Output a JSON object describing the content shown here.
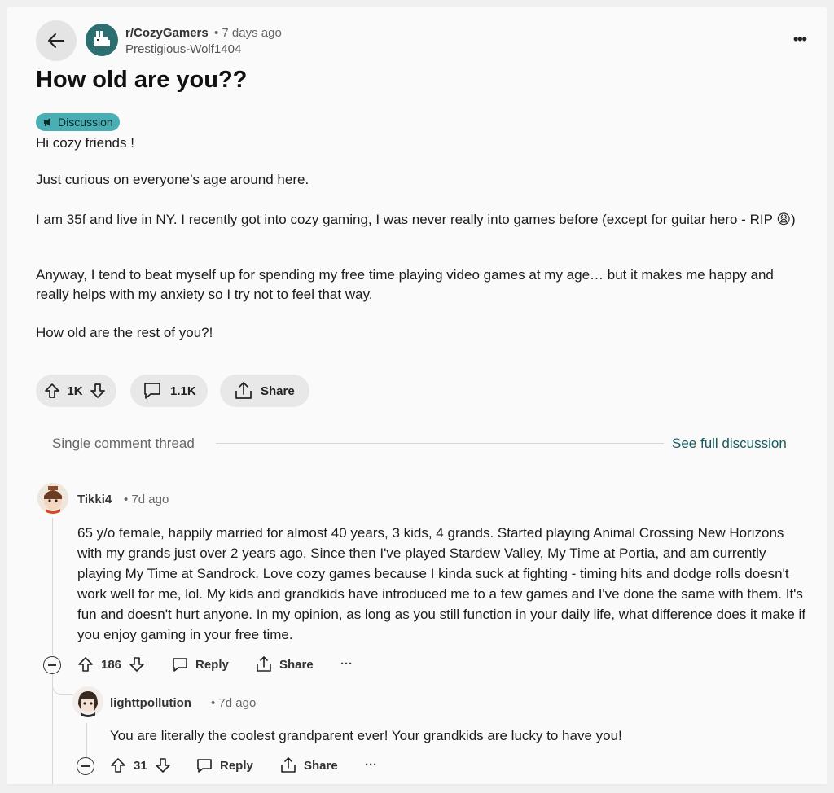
{
  "post": {
    "subreddit": "r/CozyGamers",
    "time": "• 7 days ago",
    "author": "Prestigious-Wolf1404",
    "title": "How old are you??",
    "flair": "Discussion",
    "body": [
      "Hi cozy friends !",
      "Just curious on everyone’s age around here.",
      "I am 35f and live in NY. I recently got into cozy gaming, I was never really into games before (except for guitar hero - RIP 😩)",
      "Anyway, I tend to beat myself up for spending my free time playing video games at my age… but it makes me happy and really helps with my anxiety so I try not to feel that way.",
      "How old are the rest of you?!"
    ],
    "votes": "1K",
    "comments": "1.1K",
    "share": "Share"
  },
  "thread": {
    "label": "Single comment thread",
    "see_full": "See full discussion"
  },
  "comments": [
    {
      "user": "Tikki4",
      "time": "• 7d ago",
      "text": "65 y/o female, happily married for almost 40 years, 3 kids, 4 grands. Started playing Animal Crossing New Horizons with my grands just over 2 years ago. Since then I've played Stardew Valley, My Time at Portia, and am currently playing My Time at Sandrock. Love cozy games because I kinda suck at fighting - timing hits and dodge rolls doesn't work well for me, lol. My kids and grandkids have introduced me to a few games and I've done the same with them. It's fun and doesn't hurt anyone. In my opinion, as long as you still function in your daily life, what difference does it make if you enjoy gaming in your free time.",
      "votes": "186",
      "reply": "Reply",
      "share": "Share",
      "more": "···"
    },
    {
      "user": "lighttpollution",
      "time": "• 7d ago",
      "text": "You are literally the coolest grandparent ever! Your grandkids are lucky to have you!",
      "votes": "31",
      "reply": "Reply",
      "share": "Share",
      "more": "···"
    }
  ],
  "ui": {
    "more_top": "•••",
    "colors": {
      "accent": "#48b0b4",
      "link": "#155a5c",
      "avatar_bg": "#2d6f70"
    }
  }
}
